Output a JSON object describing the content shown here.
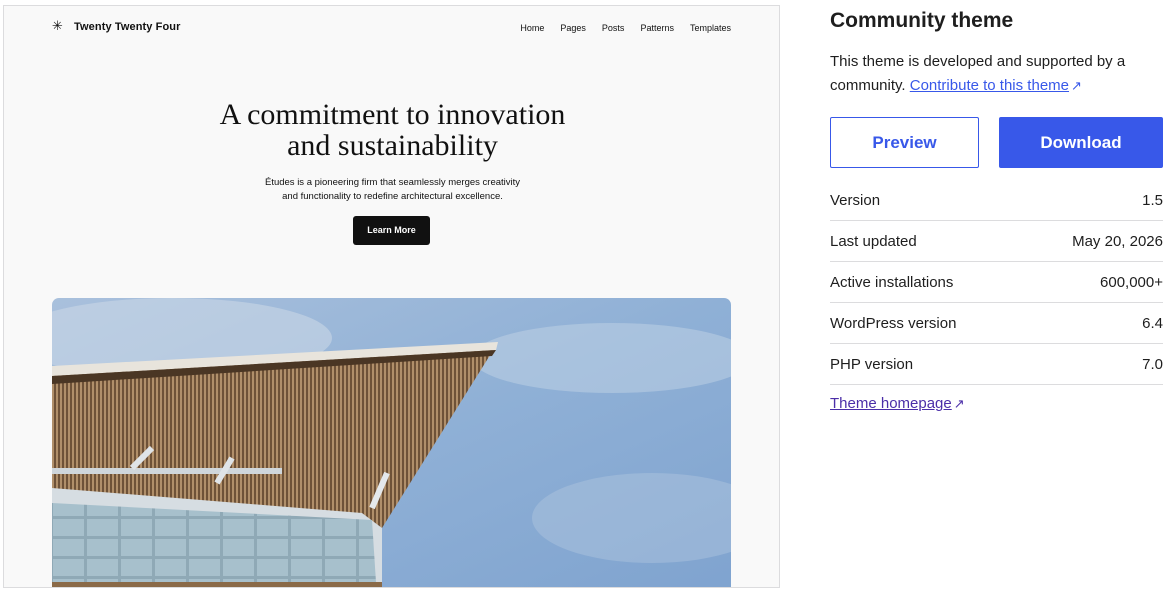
{
  "preview": {
    "site_title": "Twenty Twenty Four",
    "logo_glyph": "✳",
    "nav": [
      "Home",
      "Pages",
      "Posts",
      "Patterns",
      "Templates"
    ],
    "heading_lines": [
      "A commitment to innovation",
      "and sustainability"
    ],
    "text_lines": [
      "Études is a pioneering firm that seamlessly merges creativity",
      "and functionality to redefine architectural excellence."
    ],
    "button_label": "Learn More"
  },
  "sidebar": {
    "title": "Community theme",
    "description": "This theme is developed and supported by a community.",
    "contribute_link": "Contribute to this theme",
    "arrow_glyph": "↗",
    "preview_label": "Preview",
    "download_label": "Download",
    "meta": [
      {
        "label": "Version",
        "value": "1.5"
      },
      {
        "label": "Last updated",
        "value": "May 20, 2026"
      },
      {
        "label": "Active installations",
        "value": "600,000+"
      },
      {
        "label": "WordPress version",
        "value": "6.4"
      },
      {
        "label": "PHP version",
        "value": "7.0"
      }
    ],
    "homepage_link": "Theme homepage"
  },
  "colors": {
    "accent": "#3858e9",
    "visited_link": "#4b2ea8",
    "sky": "#8fb0d6"
  }
}
